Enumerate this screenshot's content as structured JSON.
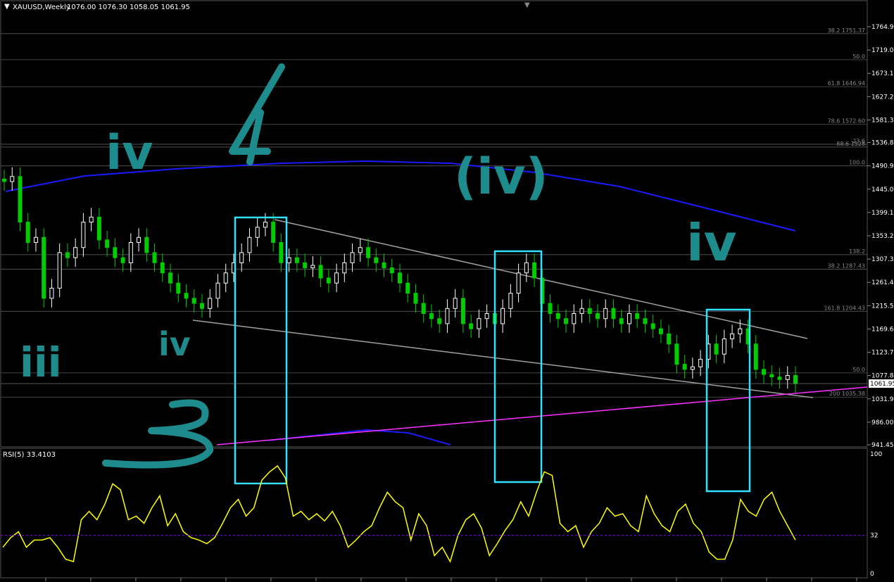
{
  "header": {
    "symbol": "XAUUSD,Weekly",
    "ohlc": "1076.00 1076.30 1058.05 1061.95"
  },
  "rsi_header": "RSI(5) 33.4103",
  "price_axis": {
    "ticks": [
      "1764.95",
      "1719.05",
      "1673.15",
      "1627.25",
      "1581.35",
      "1536.80",
      "1490.90",
      "1445.00",
      "1399.10",
      "1353.20",
      "1307.30",
      "1261.40",
      "1215.50",
      "1169.60",
      "1123.70",
      "1077.80",
      "1031.90",
      "986.00",
      "941.45"
    ],
    "current_price": "1061.95"
  },
  "rsi_axis": {
    "ticks": [
      "100",
      "32",
      "0"
    ]
  },
  "fib_labels": [
    {
      "text": "38.2 1751.37",
      "price": 1751.37
    },
    {
      "text": "50.0",
      "price": 1700
    },
    {
      "text": "61.8 1646.94",
      "price": 1646.94
    },
    {
      "text": "78.6 1572.60",
      "price": 1572.6
    },
    {
      "text": "88.6 1528",
      "price": 1528
    },
    {
      "text": "23.6",
      "price": 1533.5
    },
    {
      "text": "100.0",
      "price": 1490.9
    },
    {
      "text": "138.2",
      "price": 1316
    },
    {
      "text": "38.2 1287.43",
      "price": 1287.43
    },
    {
      "text": "161.8 1204.43",
      "price": 1204.43
    },
    {
      "text": "50.0",
      "price": 1083
    },
    {
      "text": "200 1035.38",
      "price": 1035.38
    }
  ],
  "annotations": [
    {
      "text": "iv",
      "color": "#1e8c8c"
    },
    {
      "text": "4",
      "color": "#1e8c8c"
    },
    {
      "text": "(iv)",
      "color": "#1e8c8c"
    },
    {
      "text": "iv",
      "color": "#1e8c8c"
    },
    {
      "text": "iii",
      "color": "#1e8c8c"
    },
    {
      "text": "iv",
      "color": "#1e8c8c"
    },
    {
      "text": "3",
      "color": "#1e8c8c"
    }
  ],
  "colors": {
    "background": "#000000",
    "bull_candle": "#ffffff",
    "bear_candle": "#00cc00",
    "ma": "#1a1aff",
    "trendline": "#ff33ff",
    "wedge": "#a0a0a0",
    "box": "#33e0ff",
    "rsi": "#ffff00",
    "rsi_level": "#8000ff"
  },
  "chart_data": [
    {
      "type": "candlestick",
      "symbol": "XAUUSD",
      "timeframe": "Weekly",
      "ylim": [
        941.45,
        1785
      ],
      "close_path": [
        1460,
        1470,
        1380,
        1340,
        1350,
        1230,
        1250,
        1320,
        1310,
        1330,
        1380,
        1390,
        1345,
        1330,
        1310,
        1300,
        1340,
        1350,
        1320,
        1300,
        1280,
        1260,
        1240,
        1230,
        1220,
        1210,
        1230,
        1260,
        1280,
        1300,
        1320,
        1350,
        1370,
        1380,
        1340,
        1300,
        1310,
        1300,
        1290,
        1295,
        1270,
        1260,
        1280,
        1300,
        1320,
        1330,
        1310,
        1300,
        1290,
        1280,
        1260,
        1240,
        1220,
        1200,
        1190,
        1180,
        1210,
        1230,
        1180,
        1170,
        1190,
        1200,
        1180,
        1210,
        1240,
        1280,
        1300,
        1270,
        1220,
        1200,
        1190,
        1180,
        1200,
        1210,
        1200,
        1190,
        1210,
        1190,
        1180,
        1200,
        1190,
        1180,
        1170,
        1160,
        1140,
        1100,
        1090,
        1095,
        1110,
        1140,
        1120,
        1150,
        1160,
        1170,
        1140,
        1090,
        1080,
        1075,
        1070,
        1078,
        1062
      ],
      "current": 1061.95
    },
    {
      "type": "line",
      "name": "RSI(5)",
      "ylim": [
        0,
        100
      ],
      "level": 32,
      "values": [
        22,
        30,
        35,
        22,
        28,
        28,
        30,
        22,
        12,
        10,
        45,
        52,
        45,
        58,
        75,
        70,
        45,
        48,
        42,
        55,
        65,
        40,
        50,
        35,
        30,
        28,
        25,
        30,
        42,
        55,
        62,
        48,
        55,
        78,
        85,
        90,
        80,
        48,
        52,
        45,
        50,
        44,
        52,
        40,
        22,
        28,
        35,
        40,
        55,
        68,
        60,
        55,
        28,
        50,
        40,
        15,
        22,
        10,
        32,
        45,
        50,
        38,
        15,
        25,
        36,
        45,
        60,
        48,
        68,
        85,
        82,
        42,
        35,
        40,
        22,
        35,
        42,
        55,
        48,
        50,
        40,
        35,
        65,
        50,
        40,
        35,
        52,
        58,
        42,
        35,
        18,
        12,
        12,
        28,
        62,
        52,
        48,
        62,
        68,
        52,
        40,
        28
      ]
    }
  ]
}
